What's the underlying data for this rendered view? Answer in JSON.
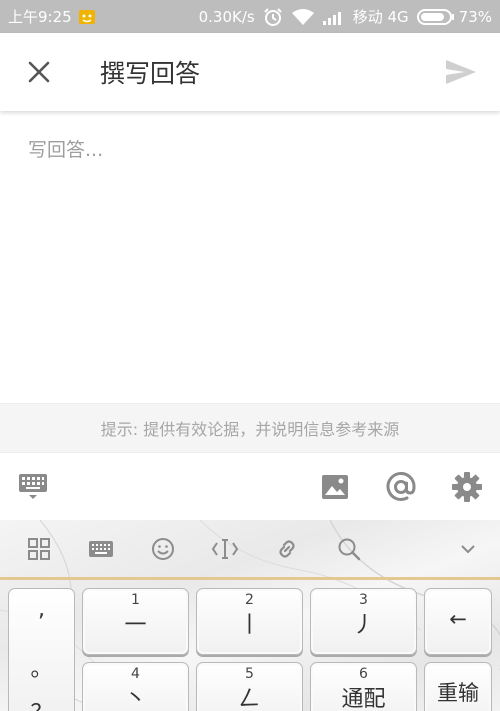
{
  "status_bar": {
    "time": "上午9:25",
    "speed": "0.30K/s",
    "carrier": "移动 4G",
    "battery": "73%"
  },
  "app_bar": {
    "title": "撰写回答"
  },
  "editor": {
    "placeholder": "写回答..."
  },
  "hint": {
    "text": "提示: 提供有效论据，并说明信息参考来源"
  },
  "keyboard": {
    "punctuation": [
      ",",
      "。",
      "？"
    ],
    "keys": [
      {
        "num": "1",
        "glyph": "一"
      },
      {
        "num": "2",
        "glyph": "丨"
      },
      {
        "num": "3",
        "glyph": "丿"
      },
      {
        "num": "4",
        "glyph": "丶"
      },
      {
        "num": "5",
        "glyph": "𠃋"
      },
      {
        "num": "6",
        "glyph": "通配"
      }
    ],
    "backspace": "←",
    "retype": "重输"
  },
  "colors": {
    "status_bar": "#bdbdbd",
    "hint_bg": "#f5f5f5",
    "icon_gray": "#8a8a8a",
    "divider_gold": "#e3c98f"
  }
}
